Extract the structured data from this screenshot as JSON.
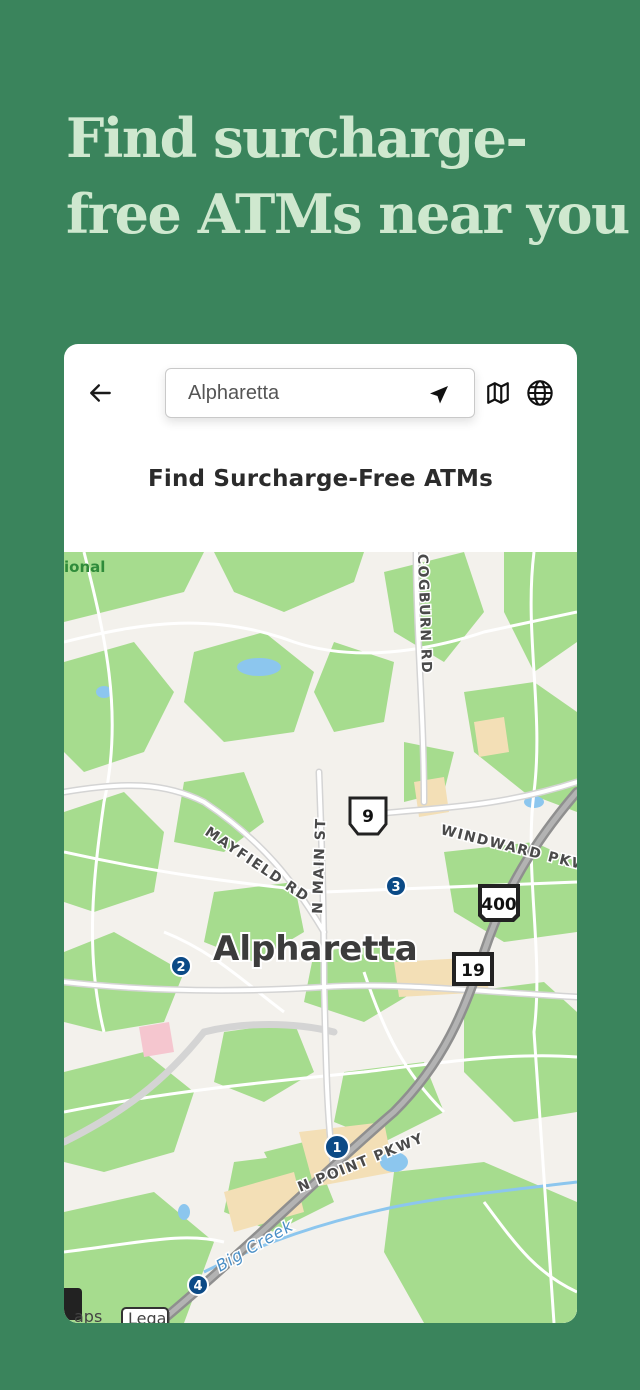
{
  "promo": {
    "headline_line1": "Find surcharge-",
    "headline_line2": "free ATMs near you"
  },
  "search": {
    "value": "Alpharetta",
    "placeholder": "Alpharetta"
  },
  "card": {
    "title": "Find Surcharge-Free ATMs"
  },
  "map": {
    "city_label": "Alpharetta",
    "roads": {
      "cogburn": "COGBURN RD",
      "mayfield": "MAYFIELD RD",
      "main": "N MAIN ST",
      "windward": "WINDWARD PKWY",
      "npoint": "N POINT PKWY"
    },
    "water_label": "Big Creek",
    "park_label": "ional",
    "shields": {
      "sr9": "9",
      "i400": "400",
      "us19": "19"
    },
    "pins": [
      "1",
      "2",
      "3",
      "4"
    ],
    "attribution": "aps",
    "legal": "Legal"
  },
  "icons": {
    "back": "arrow-left-icon",
    "locate": "location-arrow-icon",
    "map_view": "map-icon",
    "language": "globe-icon"
  },
  "colors": {
    "background": "#3a845c",
    "headline": "#cfe8cf",
    "pin": "#0b4a86",
    "park": "#9fd98a"
  }
}
